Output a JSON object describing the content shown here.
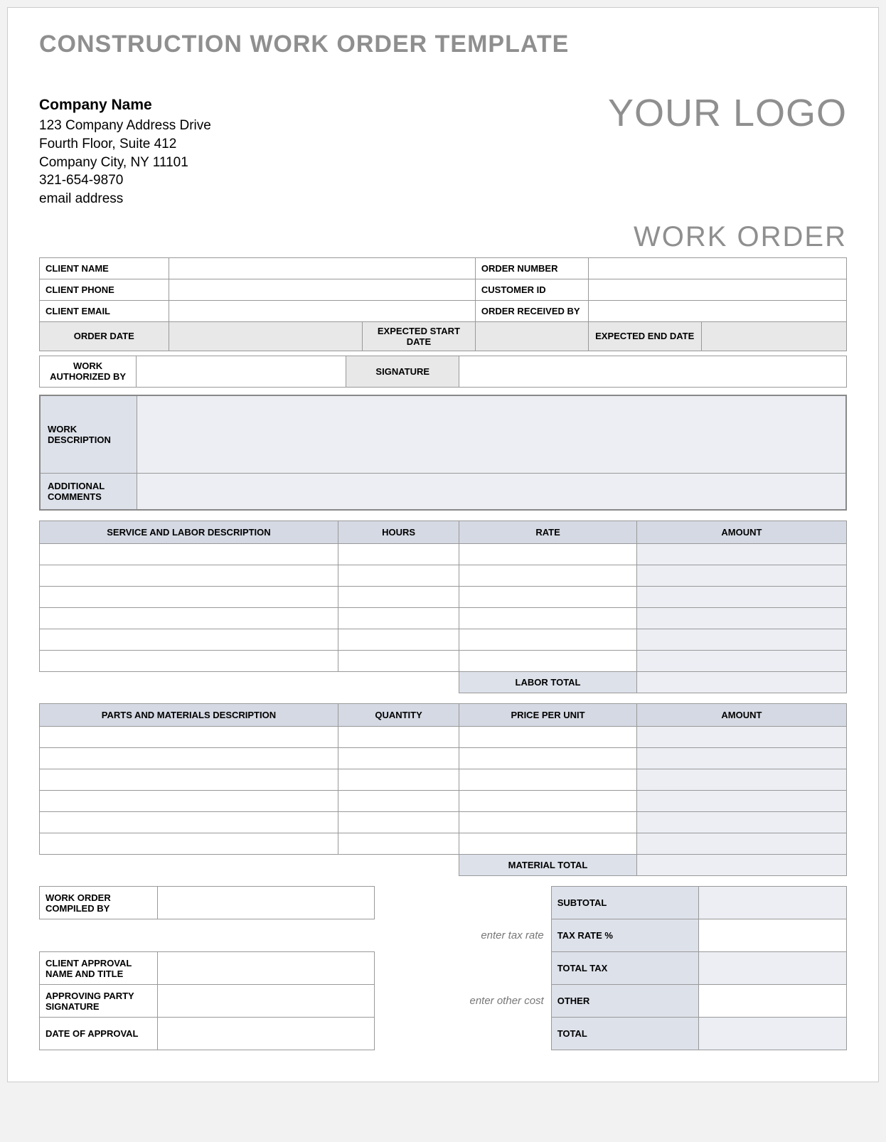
{
  "title": "CONSTRUCTION WORK ORDER TEMPLATE",
  "company": {
    "name": "Company Name",
    "addr1": "123 Company Address Drive",
    "addr2": "Fourth Floor, Suite 412",
    "addr3": "Company City, NY  11101",
    "phone": "321-654-9870",
    "email": "email address"
  },
  "logo": "YOUR LOGO",
  "wo_label": "WORK ORDER",
  "client": {
    "name_lbl": "CLIENT NAME",
    "phone_lbl": "CLIENT PHONE",
    "email_lbl": "CLIENT EMAIL",
    "order_num_lbl": "ORDER NUMBER",
    "cust_id_lbl": "CUSTOMER ID",
    "recv_by_lbl": "ORDER RECEIVED BY"
  },
  "dates": {
    "order_date_lbl": "ORDER DATE",
    "exp_start_lbl": "EXPECTED START DATE",
    "exp_end_lbl": "EXPECTED END DATE"
  },
  "auth": {
    "by_lbl": "WORK AUTHORIZED BY",
    "sig_lbl": "SIGNATURE"
  },
  "desc": {
    "work_lbl": "WORK DESCRIPTION",
    "add_lbl": "ADDITIONAL COMMENTS"
  },
  "labor": {
    "col1": "SERVICE AND LABOR DESCRIPTION",
    "col2": "HOURS",
    "col3": "RATE",
    "col4": "AMOUNT",
    "total_lbl": "LABOR TOTAL"
  },
  "parts": {
    "col1": "PARTS AND MATERIALS DESCRIPTION",
    "col2": "QUANTITY",
    "col3": "PRICE PER UNIT",
    "col4": "AMOUNT",
    "total_lbl": "MATERIAL TOTAL"
  },
  "compiled_lbl": "WORK ORDER COMPILED BY",
  "hints": {
    "tax": "enter tax rate",
    "other": "enter other cost"
  },
  "totals": {
    "subtotal": "SUBTOTAL",
    "taxrate": "TAX RATE %",
    "totaltax": "TOTAL TAX",
    "other": "OTHER",
    "total": "TOTAL"
  },
  "approval": {
    "name_lbl": "CLIENT APPROVAL NAME AND TITLE",
    "sig_lbl": "APPROVING PARTY SIGNATURE",
    "date_lbl": "DATE OF APPROVAL"
  }
}
